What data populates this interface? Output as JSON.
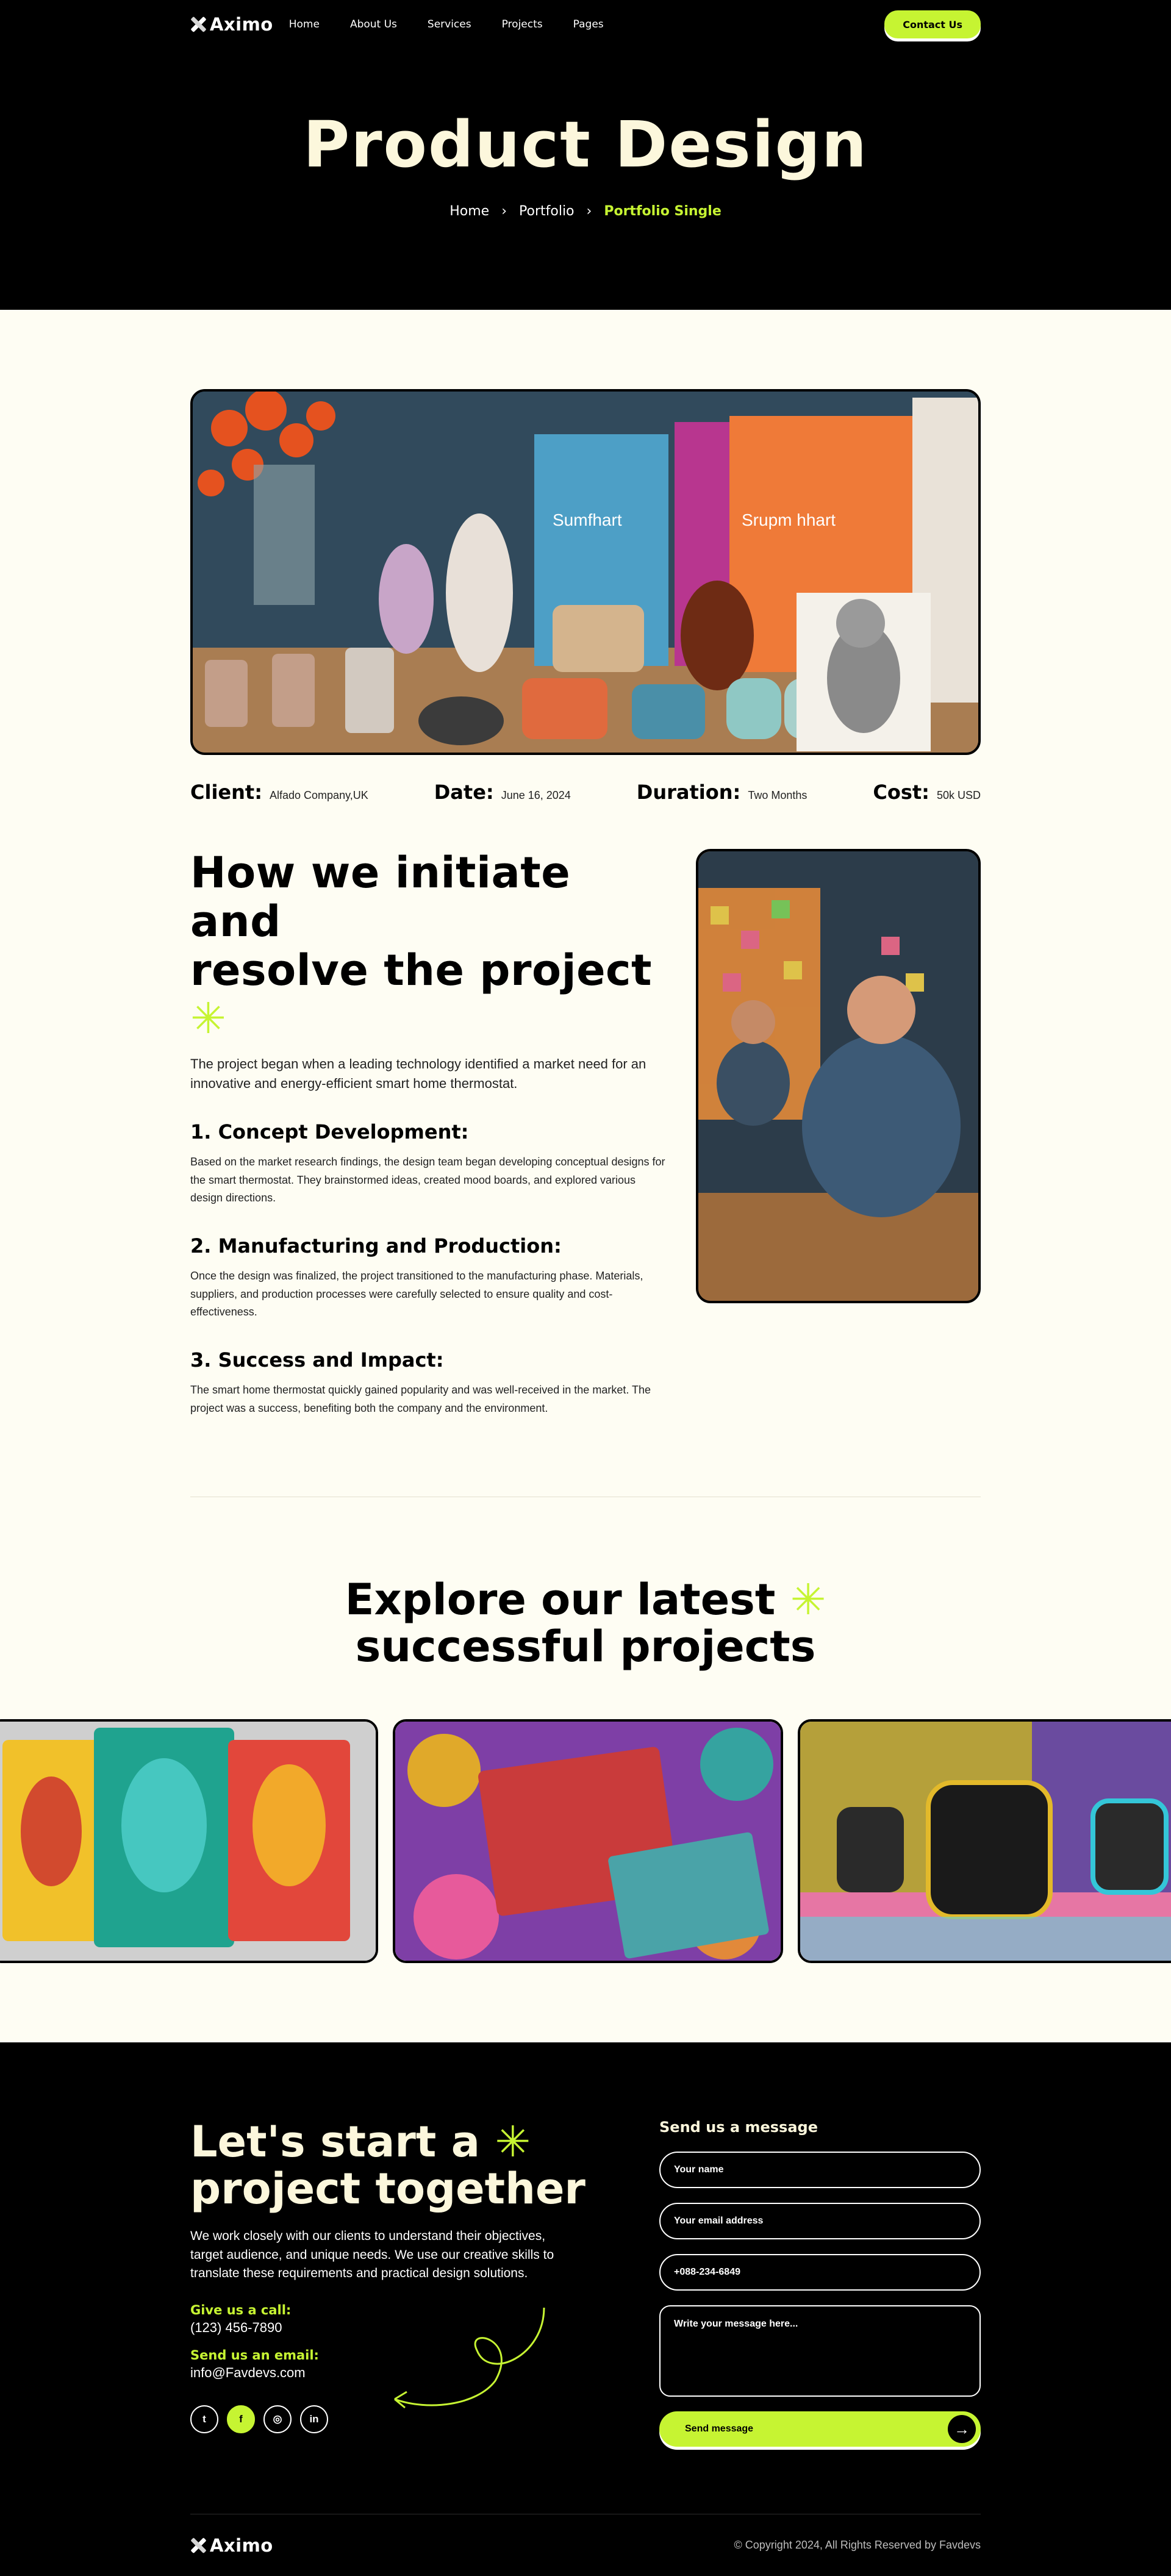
{
  "brand": {
    "name": "Aximo"
  },
  "nav": {
    "items": [
      "Home",
      "About Us",
      "Services",
      "Projects",
      "Pages"
    ],
    "contact_label": "Contact Us"
  },
  "hero": {
    "title": "Product Design",
    "breadcrumb": [
      "Home",
      "Portfolio",
      "Portfolio Single"
    ]
  },
  "meta": [
    {
      "key": "Client:",
      "value": "Alfado Company,UK"
    },
    {
      "key": "Date:",
      "value": "June 16, 2024"
    },
    {
      "key": "Duration:",
      "value": "Two Months"
    },
    {
      "key": "Cost:",
      "value": "50k USD"
    }
  ],
  "story": {
    "title_line1": "How we initiate and",
    "title_line2": "resolve the project",
    "lead": "The project began when a leading technology identified a market need for an innovative and energy-efficient smart home thermostat.",
    "steps": [
      {
        "title": "1. Concept Development:",
        "text": "Based on the market research findings, the design team began developing conceptual designs for the smart thermostat. They brainstormed ideas, created mood boards, and explored various design directions."
      },
      {
        "title": "2. Manufacturing and Production:",
        "text": "Once the design was finalized, the project transitioned to the manufacturing phase. Materials, suppliers, and production processes were carefully selected to ensure quality and cost-effectiveness."
      },
      {
        "title": "3. Success and Impact:",
        "text": "The smart home thermostat quickly gained popularity and was well-received in the market. The project was a success, benefiting both the company and the environment."
      }
    ]
  },
  "explore": {
    "line1": "Explore our latest",
    "line2": "successful projects"
  },
  "cta": {
    "title_line1": "Let's start a",
    "title_line2": "project together",
    "text": "We work closely with our clients to understand their objectives, target audience, and unique needs. We use our creative skills to translate these requirements and practical design solutions.",
    "call_label": "Give us a call:",
    "call_value": "(123) 456-7890",
    "email_label": "Send us an email:",
    "email_value": "info@Favdevs.com"
  },
  "form": {
    "title": "Send us a message",
    "name_placeholder": "Your name",
    "email_placeholder": "Your email address",
    "phone_placeholder": "+088-234-6849",
    "message_placeholder": "Write your message here...",
    "send_label": "Send message"
  },
  "footer": {
    "copyright": "© Copyright 2024, All Rights Reserved by Favdevs"
  },
  "colors": {
    "accent": "#c6f432",
    "cream": "#fcf7dc",
    "bg": "#fefdf3"
  }
}
